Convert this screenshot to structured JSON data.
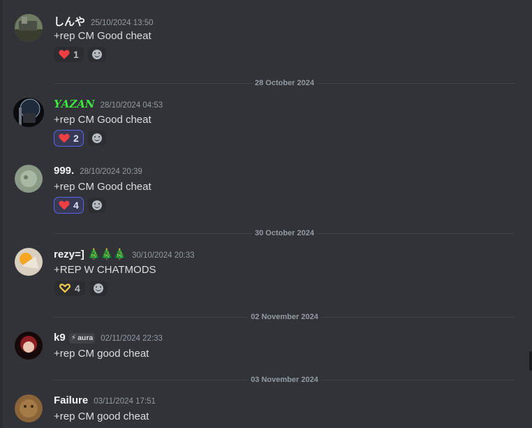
{
  "messages": [
    {
      "username": "しんや",
      "timestamp": "25/10/2024 13:50",
      "content": "+rep CM Good cheat",
      "reactions": [
        {
          "icon": "heart-icon",
          "count": "1",
          "me": false
        }
      ]
    },
    {
      "username": "𝒀𝑨𝒁𝑨𝑵",
      "username_color": "#3de83d",
      "timestamp": "28/10/2024 04:53",
      "content": "+rep CM Good cheat",
      "reactions": [
        {
          "icon": "heart-icon",
          "count": "2",
          "me": true
        }
      ]
    },
    {
      "username": "999.",
      "timestamp": "28/10/2024 20:39",
      "content": "+rep CM Good cheat",
      "reactions": [
        {
          "icon": "heart-icon",
          "count": "4",
          "me": true
        }
      ]
    },
    {
      "username": "rezy=] 🎄🎄🎄",
      "timestamp": "30/10/2024 20:33",
      "content": "+REP W CHATMODS",
      "reactions": [
        {
          "icon": "heart-hands-icon",
          "count": "4",
          "me": false
        }
      ]
    },
    {
      "username": "k9",
      "badge": "aura",
      "timestamp": "02/11/2024 22:33",
      "content": "+rep CM good cheat"
    },
    {
      "username": "Failure",
      "timestamp": "03/11/2024 17:51",
      "content": "+rep CM good cheat"
    }
  ],
  "dividers": [
    "28 October 2024",
    "30 October 2024",
    "02 November 2024",
    "03 November 2024"
  ],
  "colors": {
    "background": "#313338",
    "accent": "#5865f2",
    "heart": "#f23f43"
  }
}
